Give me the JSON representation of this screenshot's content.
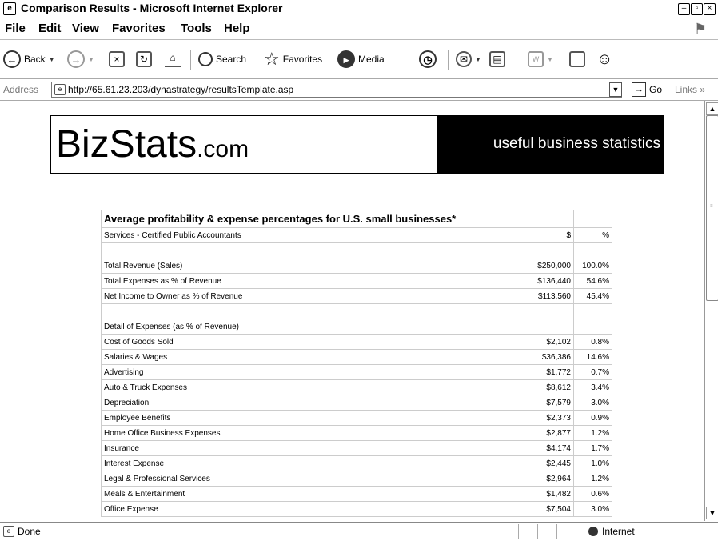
{
  "window": {
    "title": "Comparison Results - Microsoft Internet Explorer"
  },
  "menu": [
    "File",
    "Edit",
    "View",
    "Favorites",
    "Tools",
    "Help"
  ],
  "toolbar": {
    "back_label": "Back",
    "search_label": "Search",
    "favorites_label": "Favorites",
    "media_label": "Media"
  },
  "address": {
    "label": "Address",
    "url": "http://65.61.23.203/dynastrategy/resultsTemplate.asp",
    "go_label": "Go",
    "links_label": "Links"
  },
  "page": {
    "logo_main": "BizStats",
    "logo_domain": ".com",
    "tagline": "useful business statistics",
    "table": {
      "title": "Average profitability & expense percentages for U.S. small businesses*",
      "subtitle": "Services - Certified Public Accountants",
      "col_dollar": "$",
      "col_pct": "%",
      "rows": [
        {
          "label": "",
          "amount": "",
          "pct": ""
        },
        {
          "label": "Total Revenue (Sales)",
          "amount": "$250,000",
          "pct": "100.0%"
        },
        {
          "label": "Total Expenses as % of Revenue",
          "amount": "$136,440",
          "pct": "54.6%"
        },
        {
          "label": "Net Income to Owner as % of Revenue",
          "amount": "$113,560",
          "pct": "45.4%"
        },
        {
          "label": "",
          "amount": "",
          "pct": ""
        },
        {
          "label": "Detail of Expenses (as % of Revenue)",
          "amount": "",
          "pct": ""
        },
        {
          "label": "Cost of Goods Sold",
          "amount": "$2,102",
          "pct": "0.8%"
        },
        {
          "label": "Salaries & Wages",
          "amount": "$36,386",
          "pct": "14.6%"
        },
        {
          "label": "Advertising",
          "amount": "$1,772",
          "pct": "0.7%"
        },
        {
          "label": "Auto & Truck Expenses",
          "amount": "$8,612",
          "pct": "3.4%"
        },
        {
          "label": "Depreciation",
          "amount": "$7,579",
          "pct": "3.0%"
        },
        {
          "label": "Employee Benefits",
          "amount": "$2,373",
          "pct": "0.9%"
        },
        {
          "label": "Home Office Business Expenses",
          "amount": "$2,877",
          "pct": "1.2%"
        },
        {
          "label": "Insurance",
          "amount": "$4,174",
          "pct": "1.7%"
        },
        {
          "label": "Interest Expense",
          "amount": "$2,445",
          "pct": "1.0%"
        },
        {
          "label": "Legal & Professional Services",
          "amount": "$2,964",
          "pct": "1.2%"
        },
        {
          "label": "Meals & Entertainment",
          "amount": "$1,482",
          "pct": "0.6%"
        },
        {
          "label": "Office Expense",
          "amount": "$7,504",
          "pct": "3.0%"
        }
      ]
    }
  },
  "status": {
    "text": "Done",
    "zone": "Internet"
  }
}
